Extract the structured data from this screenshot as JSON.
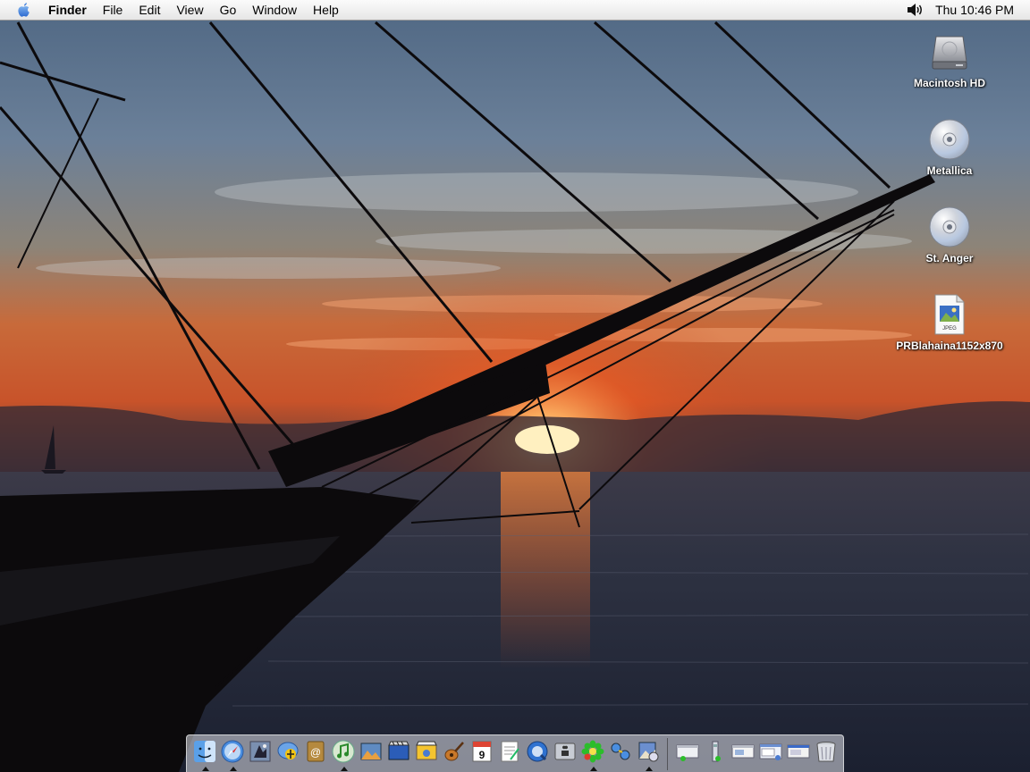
{
  "menubar": {
    "app_name": "Finder",
    "menus": [
      "File",
      "Edit",
      "View",
      "Go",
      "Window",
      "Help"
    ],
    "clock": "Thu 10:46 PM",
    "icons": {
      "apple": "apple-menu-icon",
      "volume": "volume-icon"
    }
  },
  "desktop": {
    "icons": [
      {
        "label": "Macintosh HD",
        "icon": "hard-drive-icon"
      },
      {
        "label": "Metallica",
        "icon": "cd-icon"
      },
      {
        "label": "St. Anger",
        "icon": "cd-icon"
      },
      {
        "label": "PRBlahaina1152x870",
        "icon": "jpeg-file-icon",
        "badge": "JPEG"
      }
    ]
  },
  "dock": {
    "apps": [
      {
        "icon": "finder-icon",
        "running": true
      },
      {
        "icon": "safari-icon",
        "running": true
      },
      {
        "icon": "mail-icon",
        "running": false
      },
      {
        "icon": "ichat-icon",
        "running": false
      },
      {
        "icon": "address-book-icon",
        "running": false
      },
      {
        "icon": "itunes-icon",
        "running": true
      },
      {
        "icon": "iphoto-icon",
        "running": false
      },
      {
        "icon": "imovie-icon",
        "running": false
      },
      {
        "icon": "idvd-icon",
        "running": false
      },
      {
        "icon": "garageband-icon",
        "running": false
      },
      {
        "icon": "ical-icon",
        "running": false,
        "badge": "9"
      },
      {
        "icon": "textedit-icon",
        "running": false
      },
      {
        "icon": "quicktime-icon",
        "running": false
      },
      {
        "icon": "system-preferences-icon",
        "running": false
      },
      {
        "icon": "icq-icon",
        "running": true
      },
      {
        "icon": "network-icon",
        "running": false
      },
      {
        "icon": "preview-icon",
        "running": true
      }
    ],
    "others": [
      {
        "icon": "minimized-window-icon"
      },
      {
        "icon": "utility-icon"
      },
      {
        "icon": "minimized-window-icon"
      },
      {
        "icon": "minimized-window-icon"
      },
      {
        "icon": "minimized-window-icon"
      },
      {
        "icon": "trash-icon"
      }
    ]
  },
  "colors": {
    "sky_top": "#5f7691",
    "sunset": "#e2542a",
    "sea": "#232938",
    "silhouette": "#0c0a0c"
  }
}
